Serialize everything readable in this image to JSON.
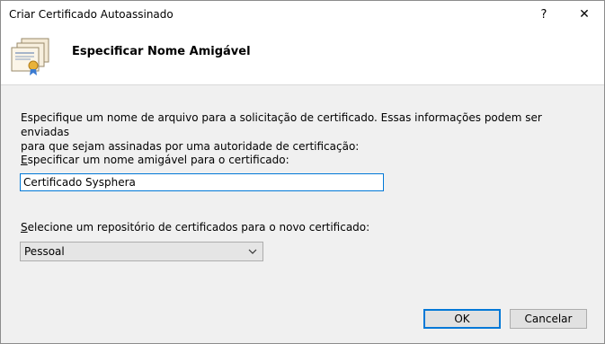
{
  "window": {
    "title": "Criar Certificado Autoassinado",
    "help_glyph": "?",
    "close_glyph": "✕"
  },
  "header": {
    "title": "Especificar Nome Amigável",
    "icon": "certificates-icon"
  },
  "main": {
    "description_line1": "Especifique um nome de arquivo para a solicitação de certificado. Essas informações podem ser enviadas",
    "description_line2": "para que sejam assinadas por uma autoridade de certificação:",
    "friendly_name_label_prefix": "E",
    "friendly_name_label_rest": "specificar um nome amigável para o certificado:",
    "friendly_name_value": "Certificado Sysphera",
    "store_label_prefix": "S",
    "store_label_rest": "elecione um repositório de certificados para o novo certificado:",
    "store_selected": "Pessoal"
  },
  "buttons": {
    "ok": "OK",
    "cancel": "Cancelar"
  },
  "colors": {
    "accent": "#0078d7",
    "header_bg": "#ffffff",
    "body_bg": "#f0f0f0"
  }
}
